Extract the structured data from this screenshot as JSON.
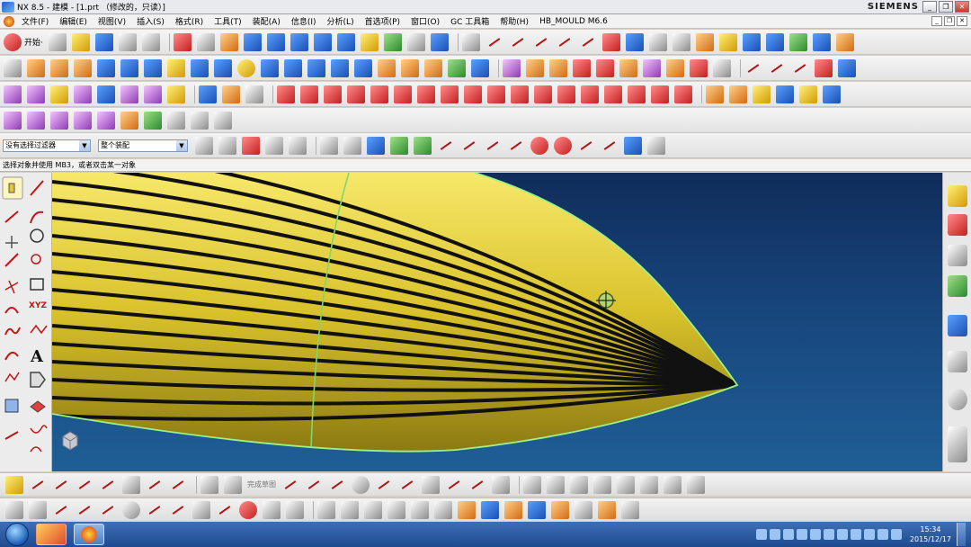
{
  "window": {
    "title": "NX 8.5 - 建模 - [1.prt （修改的，只读）]",
    "brand": "SIEMENS",
    "minimize": "_",
    "restore": "❐",
    "close": "✕"
  },
  "menubar": {
    "items": [
      "文件(F)",
      "编辑(E)",
      "视图(V)",
      "插入(S)",
      "格式(R)",
      "工具(T)",
      "装配(A)",
      "信息(I)",
      "分析(L)",
      "首选项(P)",
      "窗口(O)",
      "GC 工具箱",
      "帮助(H)",
      "HB_MOULD M6.6"
    ],
    "mdi": [
      "_",
      "❐",
      "✕"
    ]
  },
  "toolbar": {
    "start_label": "开始·"
  },
  "filterbar": {
    "type_filter": "没有选择过滤器",
    "scope": "整个装配"
  },
  "cue": "选择对象并使用 MB3，或者双击某一对象",
  "bottom": {
    "finish_sketch": "完成草图"
  },
  "taskbar": {
    "time": "15:34",
    "date": "2015/12/17"
  },
  "colors": {
    "surface": "#e8d43a",
    "edge": "#9df08a",
    "stripe": "#111111",
    "bg_top": "#102c5a",
    "bg_bottom": "#1f5f96"
  }
}
